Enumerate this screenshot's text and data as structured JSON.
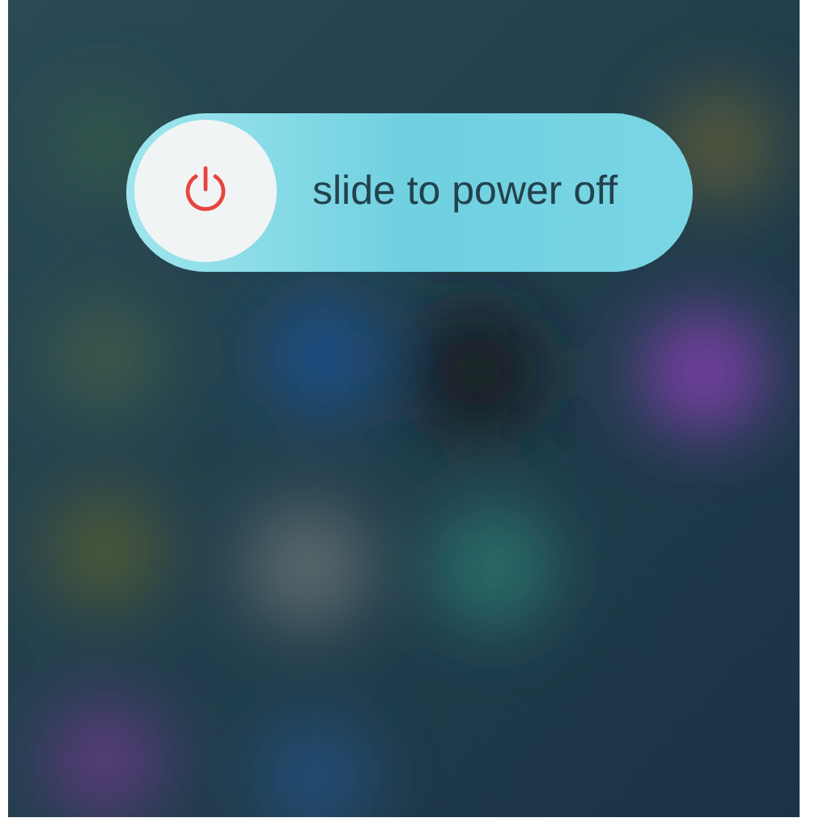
{
  "power_slider": {
    "label": "slide to power off",
    "level": 0
  }
}
